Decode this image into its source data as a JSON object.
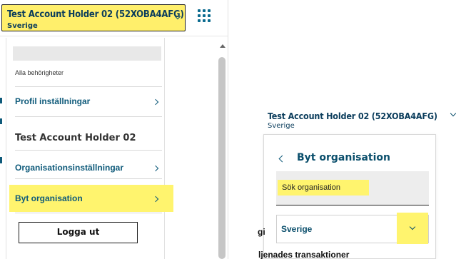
{
  "left": {
    "account_name": "Test Account Holder 02 (52XOBA4AFG)",
    "account_country": "Sverige",
    "permissions_label": "Alla behörigheter",
    "menu_items": [
      {
        "label": "Profil inställningar"
      },
      {
        "label": "Organisationsinställningar"
      },
      {
        "label": "Byt organisation"
      }
    ],
    "holder_name": "Test Account Holder 02",
    "logout_label": "Logga ut"
  },
  "right": {
    "account_name": "Test Account Holder 02 (52XOBA4AFG)",
    "account_country": "Sverige",
    "title": "Byt organisation",
    "search_placeholder": "Sök organisation",
    "select_value": "Sverige",
    "behind_fragments": [
      "gi",
      "ljenades transaktioner"
    ]
  },
  "colors": {
    "highlight": "#fff46e",
    "accent": "#0e5a7a"
  }
}
